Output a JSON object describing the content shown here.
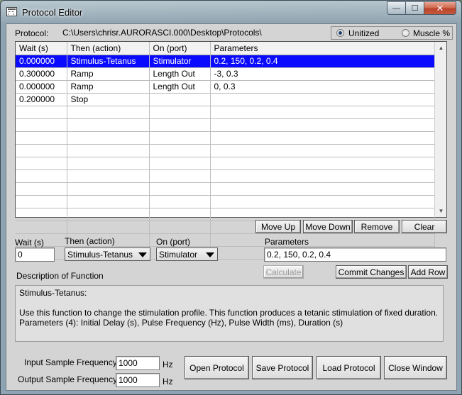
{
  "window": {
    "title": "Protocol Editor"
  },
  "titlebar": {
    "min_glyph": "—",
    "max_glyph": "☐",
    "close_glyph": "✕"
  },
  "protocol": {
    "label": "Protocol:",
    "path": "C:\\Users\\chrisr.AURORASCI.000\\Desktop\\Protocols\\"
  },
  "mode": {
    "options": [
      "Unitized",
      "Muscle %"
    ],
    "selected": "Unitized"
  },
  "table": {
    "headers": [
      "Wait (s)",
      "Then (action)",
      "On (port)",
      "Parameters"
    ],
    "rows": [
      [
        "0.000000",
        "Stimulus-Tetanus",
        "Stimulator",
        "0.2, 150, 0.2, 0.4"
      ],
      [
        "0.300000",
        "Ramp",
        "Length Out",
        "-3, 0.3"
      ],
      [
        "0.000000",
        "Ramp",
        "Length Out",
        "0, 0.3"
      ],
      [
        "0.200000",
        "Stop",
        "",
        ""
      ]
    ],
    "selected_row": 0
  },
  "row_buttons": {
    "move_up": "Move Up",
    "move_down": "Move Down",
    "remove": "Remove",
    "clear": "Clear"
  },
  "editor": {
    "wait_label": "Wait (s)",
    "wait_value": "0",
    "action_label": "Then (action)",
    "action_value": "Stimulus-Tetanus",
    "port_label": "On (port)",
    "port_value": "Stimulator",
    "params_label": "Parameters",
    "params_value": "0.2, 150, 0.2, 0.4",
    "calculate": "Calculate",
    "commit": "Commit Changes",
    "add_row": "Add Row"
  },
  "description": {
    "label": "Description of Function",
    "line1": "Stimulus-Tetanus:",
    "line2": "Use this function to change the stimulation profile.  This function produces a tetanic stimulation of fixed duration.",
    "line3": "Parameters (4): Initial Delay (s), Pulse Frequency (Hz), Pulse Width (ms), Duration (s)"
  },
  "frequency": {
    "input_label": "Input Sample Frequency",
    "input_value": "1000",
    "input_unit": "Hz",
    "output_label": "Output Sample Frequency",
    "output_value": "1000",
    "output_unit": "Hz"
  },
  "footer_buttons": {
    "open": "Open Protocol",
    "save": "Save Protocol",
    "load": "Load Protocol",
    "close": "Close Window"
  },
  "colors": {
    "selection": "#0a0aff",
    "close_button": "#c85a3e"
  }
}
